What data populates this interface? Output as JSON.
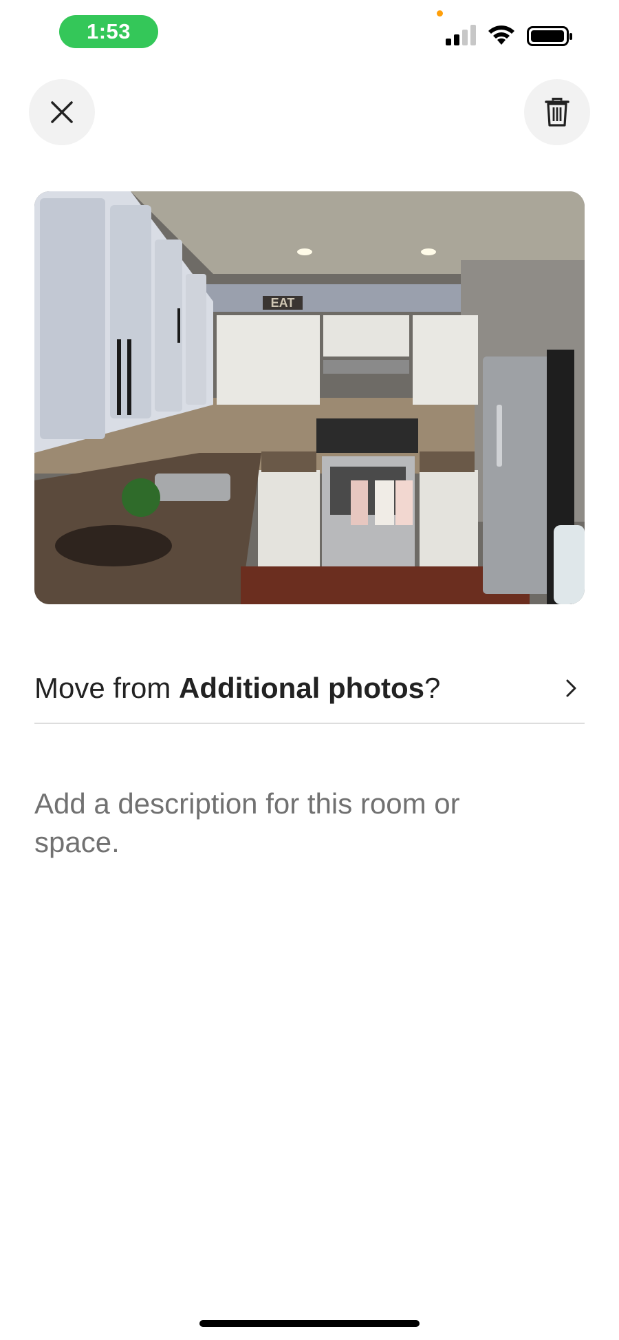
{
  "status_bar": {
    "time": "1:53",
    "icons": [
      "signal-icon",
      "wifi-icon",
      "battery-icon"
    ],
    "accent_color": "#34c759"
  },
  "header": {
    "close_icon": "close-icon",
    "delete_icon": "trash-icon"
  },
  "photo": {
    "subject": "kitchen-photo",
    "sign_text": "EAT"
  },
  "move_row": {
    "prefix": "Move from ",
    "category": "Additional photos",
    "suffix": "?",
    "icon": "chevron-right-icon"
  },
  "description": {
    "placeholder": "Add a description for this room or space."
  }
}
